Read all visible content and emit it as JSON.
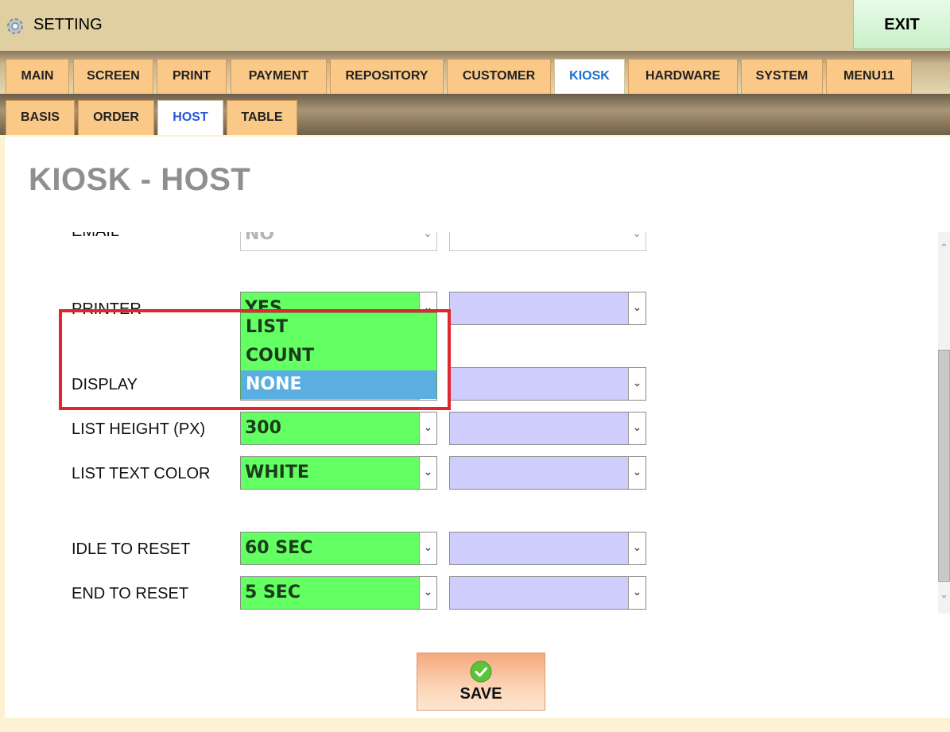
{
  "window": {
    "title": "SETTING",
    "exit_label": "EXIT"
  },
  "tabs": [
    {
      "label": "MAIN"
    },
    {
      "label": "SCREEN"
    },
    {
      "label": "PRINT"
    },
    {
      "label": "PAYMENT"
    },
    {
      "label": "REPOSITORY"
    },
    {
      "label": "CUSTOMER"
    },
    {
      "label": "KIOSK",
      "active": true
    },
    {
      "label": "HARDWARE"
    },
    {
      "label": "SYSTEM"
    },
    {
      "label": "MENU11"
    }
  ],
  "subtabs": [
    {
      "label": "BASIS"
    },
    {
      "label": "ORDER"
    },
    {
      "label": "HOST",
      "active": true
    },
    {
      "label": "TABLE"
    }
  ],
  "page": {
    "title": "KIOSK - HOST"
  },
  "form": {
    "email": {
      "label": "EMAIL",
      "value": "NO"
    },
    "printer": {
      "label": "PRINTER",
      "value": "YES"
    },
    "display": {
      "label": "DISPLAY"
    },
    "list_height": {
      "label": "LIST HEIGHT (PX)",
      "value": "300"
    },
    "list_text_color": {
      "label": "LIST TEXT COLOR",
      "value": "WHITE"
    },
    "idle_to_reset": {
      "label": "IDLE TO RESET",
      "value": "60 SEC"
    },
    "end_to_reset": {
      "label": "END TO RESET",
      "value": "5 SEC"
    }
  },
  "dropdown": {
    "options": [
      "LIST",
      "COUNT",
      "NONE"
    ],
    "selected": "NONE"
  },
  "save_label": "SAVE",
  "colors": {
    "select_green": "#63ff63",
    "select_purple": "#cfcdfc",
    "tab_orange": "#fac988",
    "highlight_red": "#e0272d",
    "active_tab_text": "#1a6fc9"
  },
  "icons": {
    "title": "gear-icon",
    "save": "check-circle-icon",
    "select_arrow": "chevron-down-icon"
  }
}
